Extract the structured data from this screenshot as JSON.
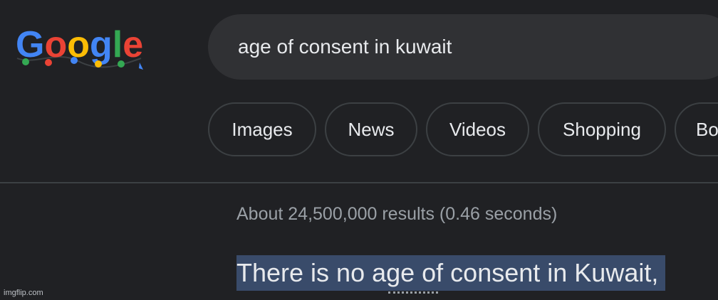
{
  "logo": {
    "text": "Google"
  },
  "search": {
    "query": "age of consent in kuwait"
  },
  "chips": [
    {
      "label": "Images"
    },
    {
      "label": "News"
    },
    {
      "label": "Videos"
    },
    {
      "label": "Shopping"
    },
    {
      "label": "Bo"
    }
  ],
  "results": {
    "stats": "About 24,500,000 results (0.46 seconds)",
    "featured_snippet": "There is no age of consent in Kuwait,"
  },
  "watermark": "imgflip.com",
  "colors": {
    "background": "#202124",
    "search_box": "#303134",
    "chip_border": "#3c4043",
    "highlight": "#394b6a",
    "text": "#e8eaed",
    "muted_text": "#9aa0a6"
  }
}
